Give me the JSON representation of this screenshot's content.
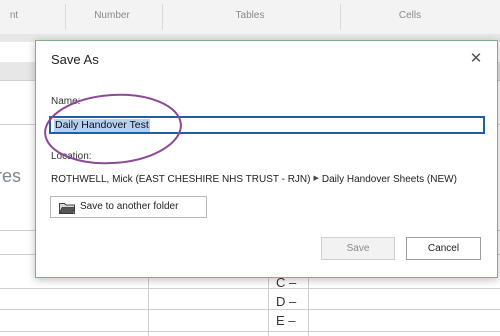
{
  "ribbon": {
    "tabs": [
      "nt",
      "Number",
      "Tables",
      "Cells"
    ]
  },
  "sheet": {
    "partial_text": "res",
    "row_letters": [
      "C –",
      "D –",
      "E –"
    ]
  },
  "dialog": {
    "title": "Save As",
    "close_glyph": "✕",
    "name_label": "Name:",
    "file_name": "Daily Handover Test",
    "location_label": "Location:",
    "location_user": "ROTHWELL, Mick (EAST CHESHIRE NHS TRUST - RJN)",
    "location_folder": "Daily Handover Sheets (NEW)",
    "path_separator": "▶",
    "other_folder_label": "Save to another folder",
    "save_label": "Save",
    "cancel_label": "Cancel"
  },
  "icons": {
    "close": "close-icon",
    "folder": "folder-icon",
    "path_separator": "chevron-right-icon"
  },
  "colors": {
    "dialog_border": "#7bb08d",
    "input_border": "#1f5ea8",
    "selection": "#b5d0f2",
    "annotation_ellipse": "#8a4a96"
  }
}
